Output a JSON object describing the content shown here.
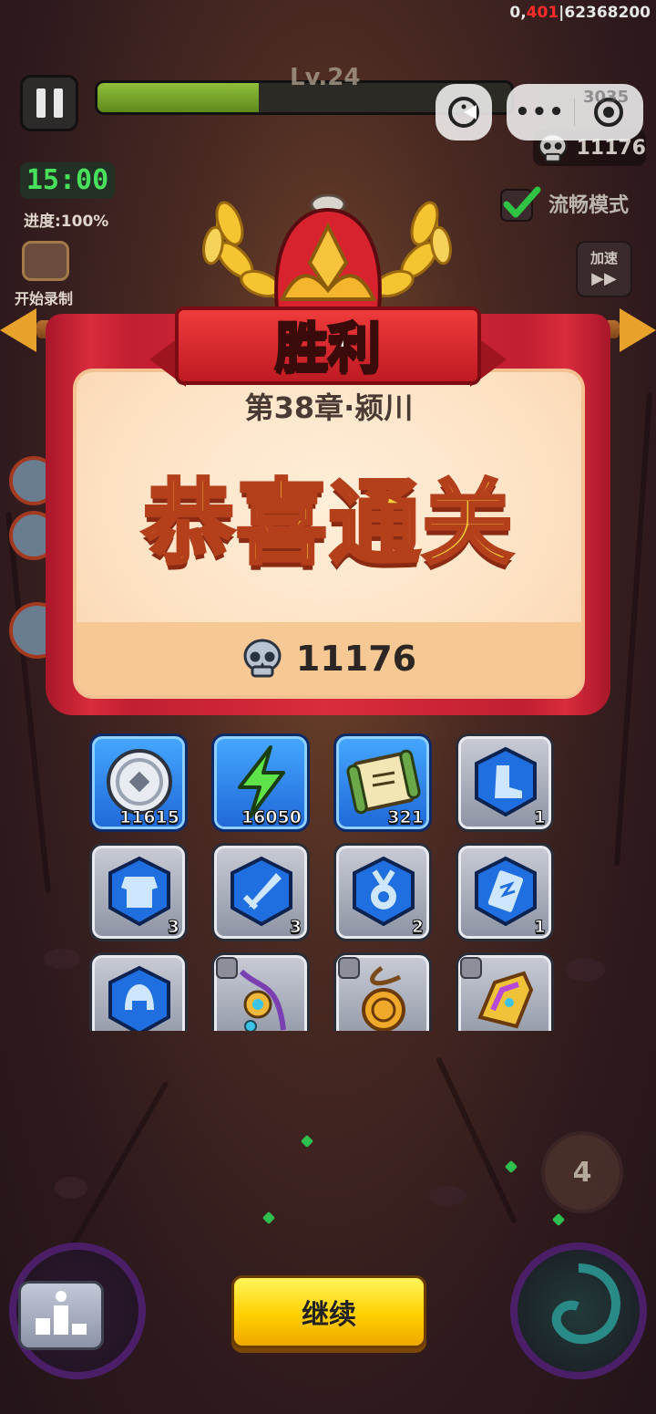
{
  "hud": {
    "top_stats_a": "0,",
    "top_stats_b": "401",
    "top_stats_c": "|62368200",
    "level": "Lv.24",
    "xp_progress": 0.39,
    "timer": "15:00",
    "progress": "进度:100%",
    "record_label": "开始录制",
    "coins_top": "3035",
    "skull_count": "11176",
    "smooth_mode": "流畅模式",
    "speed_label": "加速",
    "speed_icon": "▶▶"
  },
  "victory": {
    "title": "胜利",
    "chapter": "第38章·颍川",
    "congrats": "恭喜通关",
    "skulls": "11176"
  },
  "rewards": [
    {
      "icon": "silver-coin-icon",
      "style": "blue",
      "qty": "11615"
    },
    {
      "icon": "lightning-energy-icon",
      "style": "blue",
      "qty": "16050"
    },
    {
      "icon": "scroll-icon",
      "style": "blue",
      "qty": "321"
    },
    {
      "icon": "boot-gem-icon",
      "style": "grey",
      "qty": "1"
    },
    {
      "icon": "armor-gem-icon",
      "style": "grey",
      "qty": "3"
    },
    {
      "icon": "sword-gem-icon",
      "style": "grey",
      "qty": "3"
    },
    {
      "icon": "medal-gem-icon",
      "style": "grey",
      "qty": "2"
    },
    {
      "icon": "cloth-gem-icon",
      "style": "grey",
      "qty": "1"
    },
    {
      "icon": "helmet-gem-icon",
      "style": "grey",
      "qty": ""
    },
    {
      "icon": "jade-pendant-icon",
      "style": "grey",
      "qty": ""
    },
    {
      "icon": "gold-token-pendant-icon",
      "style": "grey",
      "qty": ""
    },
    {
      "icon": "ornate-shoulder-armor-icon",
      "style": "grey",
      "qty": ""
    }
  ],
  "buttons": {
    "continue": "继续",
    "skill_level": "4"
  },
  "colors": {
    "accent_yellow": "#ffcf00",
    "banner_red": "#d92c3c",
    "congrats_gold": "#ffd23b",
    "timer_green": "#49e05b"
  }
}
